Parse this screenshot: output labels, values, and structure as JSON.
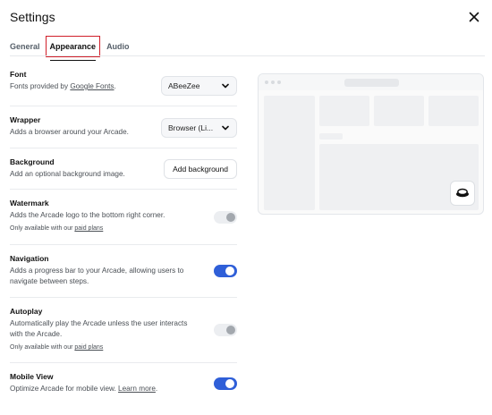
{
  "window": {
    "title": "Settings"
  },
  "tabs": [
    {
      "label": "General"
    },
    {
      "label": "Appearance"
    },
    {
      "label": "Audio"
    }
  ],
  "settings": {
    "font": {
      "title": "Font",
      "desc_prefix": "Fonts provided by ",
      "desc_link": "Google Fonts",
      "desc_suffix": ".",
      "value": "ABeeZee"
    },
    "wrapper": {
      "title": "Wrapper",
      "desc": "Adds a browser around your Arcade.",
      "value": "Browser (Li..."
    },
    "background": {
      "title": "Background",
      "desc": "Add an optional background image.",
      "button": "Add background"
    },
    "watermark": {
      "title": "Watermark",
      "desc": "Adds the Arcade logo to the bottom right corner.",
      "note_prefix": "Only available with our ",
      "note_link": "paid plans",
      "enabled": false
    },
    "navigation": {
      "title": "Navigation",
      "desc": "Adds a progress bar to your Arcade, allowing users to navigate between steps.",
      "enabled": true
    },
    "autoplay": {
      "title": "Autoplay",
      "desc": "Automatically play the Arcade unless the user interacts with the Arcade.",
      "note_prefix": "Only available with our ",
      "note_link": "paid plans",
      "enabled": false
    },
    "mobile_view": {
      "title": "Mobile View",
      "desc_prefix": "Optimize Arcade for mobile view. ",
      "desc_link": "Learn more",
      "desc_suffix": ".",
      "enabled": true
    }
  },
  "colors": {
    "accent": "#2f5fd8",
    "active_tab_highlight": "#d11f2a"
  },
  "icons": {
    "close": "close-icon",
    "chevron": "chevron-down-icon",
    "preview_badge": "arcade-logo-icon"
  }
}
